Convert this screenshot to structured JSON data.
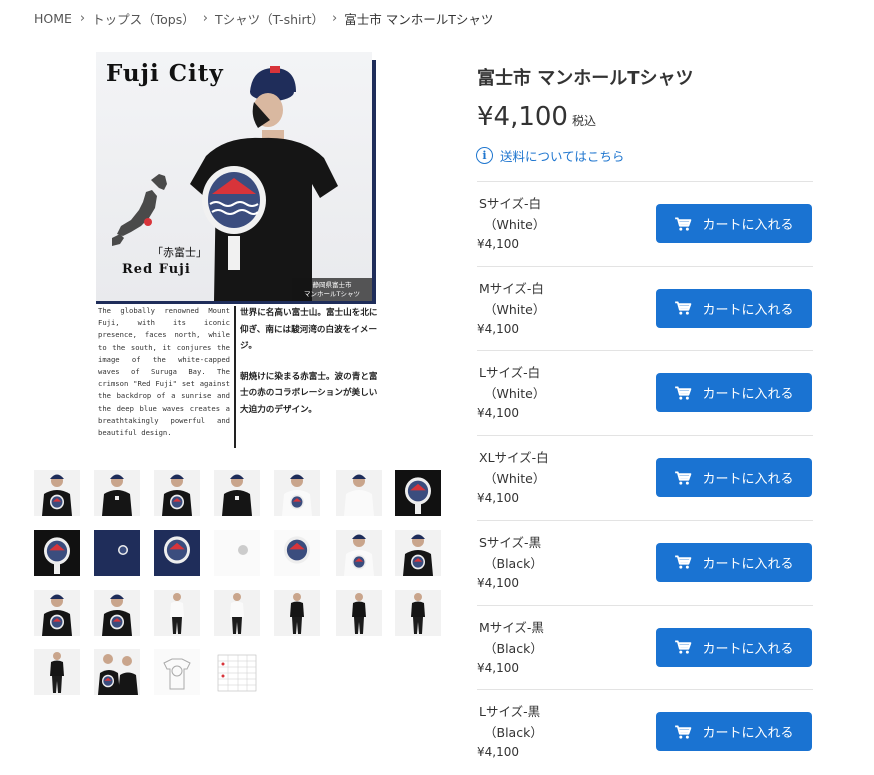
{
  "breadcrumb": [
    "HOME",
    "トップス（Tops）",
    "Tシャツ（T-shirt）",
    "富士市 マンホールTシャツ"
  ],
  "product": {
    "title": "富士市 マンホールTシャツ",
    "price": "¥4,100",
    "tax_label": "税込",
    "shipping_link": "送料についてはこちら"
  },
  "main_image": {
    "heading": "Fuji City",
    "red_fuji_jp": "「赤富士」",
    "red_fuji_en": "Red Fuji",
    "caption_line1": "静岡県富士市",
    "caption_line2": "マンホールTシャツ",
    "desc_en": "The globally renowned Mount Fuji, with its iconic presence, faces north, while to the south, it conjures the image of the white-capped waves of Suruga Bay. The crimson \"Red Fuji\" set against the backdrop of a sunrise and the deep blue waves creates a breathtakingly powerful and beautiful design.",
    "desc_jp_1": "世界に名高い富士山。富士山を北に仰ぎ、南には駿河湾の白波をイメージ。",
    "desc_jp_2": "朝焼けに染まる赤富士。波の青と富士の赤のコラボレーションが美しい大迫力のデザイン。"
  },
  "variants": [
    {
      "name": "Sサイズ-白",
      "color": "（White）",
      "price": "¥4,100",
      "button": "カートに入れる"
    },
    {
      "name": "Mサイズ-白",
      "color": "（White）",
      "price": "¥4,100",
      "button": "カートに入れる"
    },
    {
      "name": "Lサイズ-白",
      "color": "（White）",
      "price": "¥4,100",
      "button": "カートに入れる"
    },
    {
      "name": "XLサイズ-白",
      "color": "（White）",
      "price": "¥4,100",
      "button": "カートに入れる"
    },
    {
      "name": "Sサイズ-黒",
      "color": "（Black）",
      "price": "¥4,100",
      "button": "カートに入れる"
    },
    {
      "name": "Mサイズ-黒",
      "color": "（Black）",
      "price": "¥4,100",
      "button": "カートに入れる"
    },
    {
      "name": "Lサイズ-黒",
      "color": "（Black）",
      "price": "¥4,100",
      "button": "カートに入れる"
    }
  ],
  "thumbnails": [
    {
      "kind": "model-black-back"
    },
    {
      "kind": "model-black-front"
    },
    {
      "kind": "model-black-back"
    },
    {
      "kind": "model-black-front"
    },
    {
      "kind": "model-white-back"
    },
    {
      "kind": "model-white-front"
    },
    {
      "kind": "flat-black-print"
    },
    {
      "kind": "flat-black-print"
    },
    {
      "kind": "flat-navy-small"
    },
    {
      "kind": "flat-navy-print"
    },
    {
      "kind": "flat-white-small"
    },
    {
      "kind": "flat-white-print"
    },
    {
      "kind": "model-white-back"
    },
    {
      "kind": "model-black-back"
    },
    {
      "kind": "model-black-back"
    },
    {
      "kind": "model-black-back"
    },
    {
      "kind": "model-white-full"
    },
    {
      "kind": "model-white-full"
    },
    {
      "kind": "model-black-full"
    },
    {
      "kind": "model-black-full"
    },
    {
      "kind": "model-black-full"
    },
    {
      "kind": "model-black-full"
    },
    {
      "kind": "model-duo"
    },
    {
      "kind": "flat-sketch"
    },
    {
      "kind": "size-chart"
    }
  ],
  "colors": {
    "accent": "#1a73d2",
    "link": "#1f76cf",
    "navy": "#1f2d5a",
    "fuji_red": "#d8343a"
  }
}
